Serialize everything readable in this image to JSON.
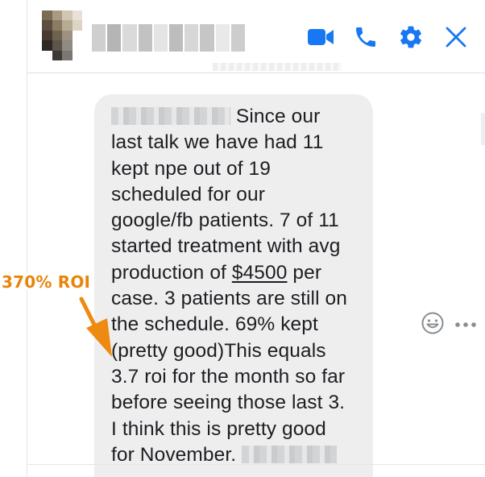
{
  "colors": {
    "accent": "#1877f2",
    "bubble": "#eeeeef",
    "annotation": "#e8840a"
  },
  "header": {
    "contact_name": "",
    "icons": [
      "video-camera-icon",
      "phone-icon",
      "gear-icon",
      "close-icon"
    ]
  },
  "message": {
    "lines": [
      "Since our",
      "last talk we have had 11",
      "kept npe out of 19",
      "scheduled for our",
      "google/fb patients. 7 of 11",
      "started treatment with avg",
      "production of ",
      "$4500",
      " per",
      "case. 3 patients are still on",
      "the schedule. 69% kept",
      "(pretty good)This equals",
      "3.7 roi for the month so far",
      "before seeing those last 3.",
      "I think this is pretty good",
      "for November."
    ]
  },
  "reactions": {
    "icons": [
      "smiley-icon",
      "more-options-icon"
    ]
  },
  "annotation": {
    "label": "370% ROI"
  }
}
